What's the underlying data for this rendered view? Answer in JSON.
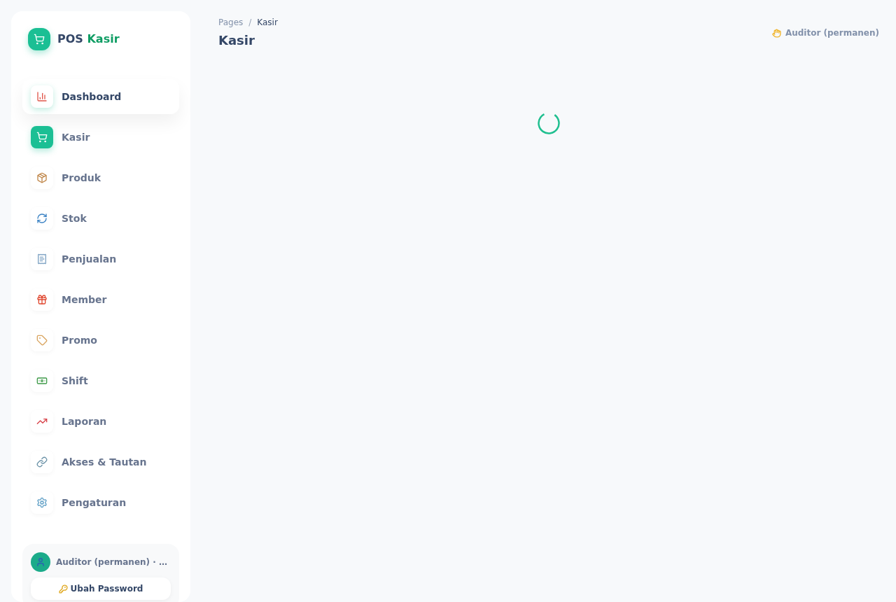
{
  "sidebar": {
    "brand": {
      "name": "POS",
      "accent": "Kasir"
    },
    "nav_items": [
      {
        "label": "Dashboard",
        "highlighted": true,
        "selected": false
      },
      {
        "label": "Kasir",
        "highlighted": false,
        "selected": true
      },
      {
        "label": "Produk",
        "highlighted": false,
        "selected": false
      },
      {
        "label": "Stok",
        "highlighted": false,
        "selected": false
      },
      {
        "label": "Penjualan",
        "highlighted": false,
        "selected": false
      },
      {
        "label": "Member",
        "highlighted": false,
        "selected": false
      },
      {
        "label": "Promo",
        "highlighted": false,
        "selected": false
      },
      {
        "label": "Shift",
        "highlighted": false,
        "selected": false
      },
      {
        "label": "Laporan",
        "highlighted": false,
        "selected": false
      },
      {
        "label": "Akses & Tautan",
        "highlighted": false,
        "selected": false
      },
      {
        "label": "Pengaturan",
        "highlighted": false,
        "selected": false
      }
    ],
    "user_card": {
      "name": "Auditor (permanen) · …",
      "button": "Ubah Password"
    }
  },
  "header": {
    "breadcrumb": {
      "separator": "/",
      "items": [
        {
          "label": "Pages",
          "current": false
        },
        {
          "label": "Kasir",
          "current": true
        }
      ]
    },
    "title": "Kasir",
    "greeting": "Auditor (permanen)"
  },
  "content": {
    "loading": true
  }
}
